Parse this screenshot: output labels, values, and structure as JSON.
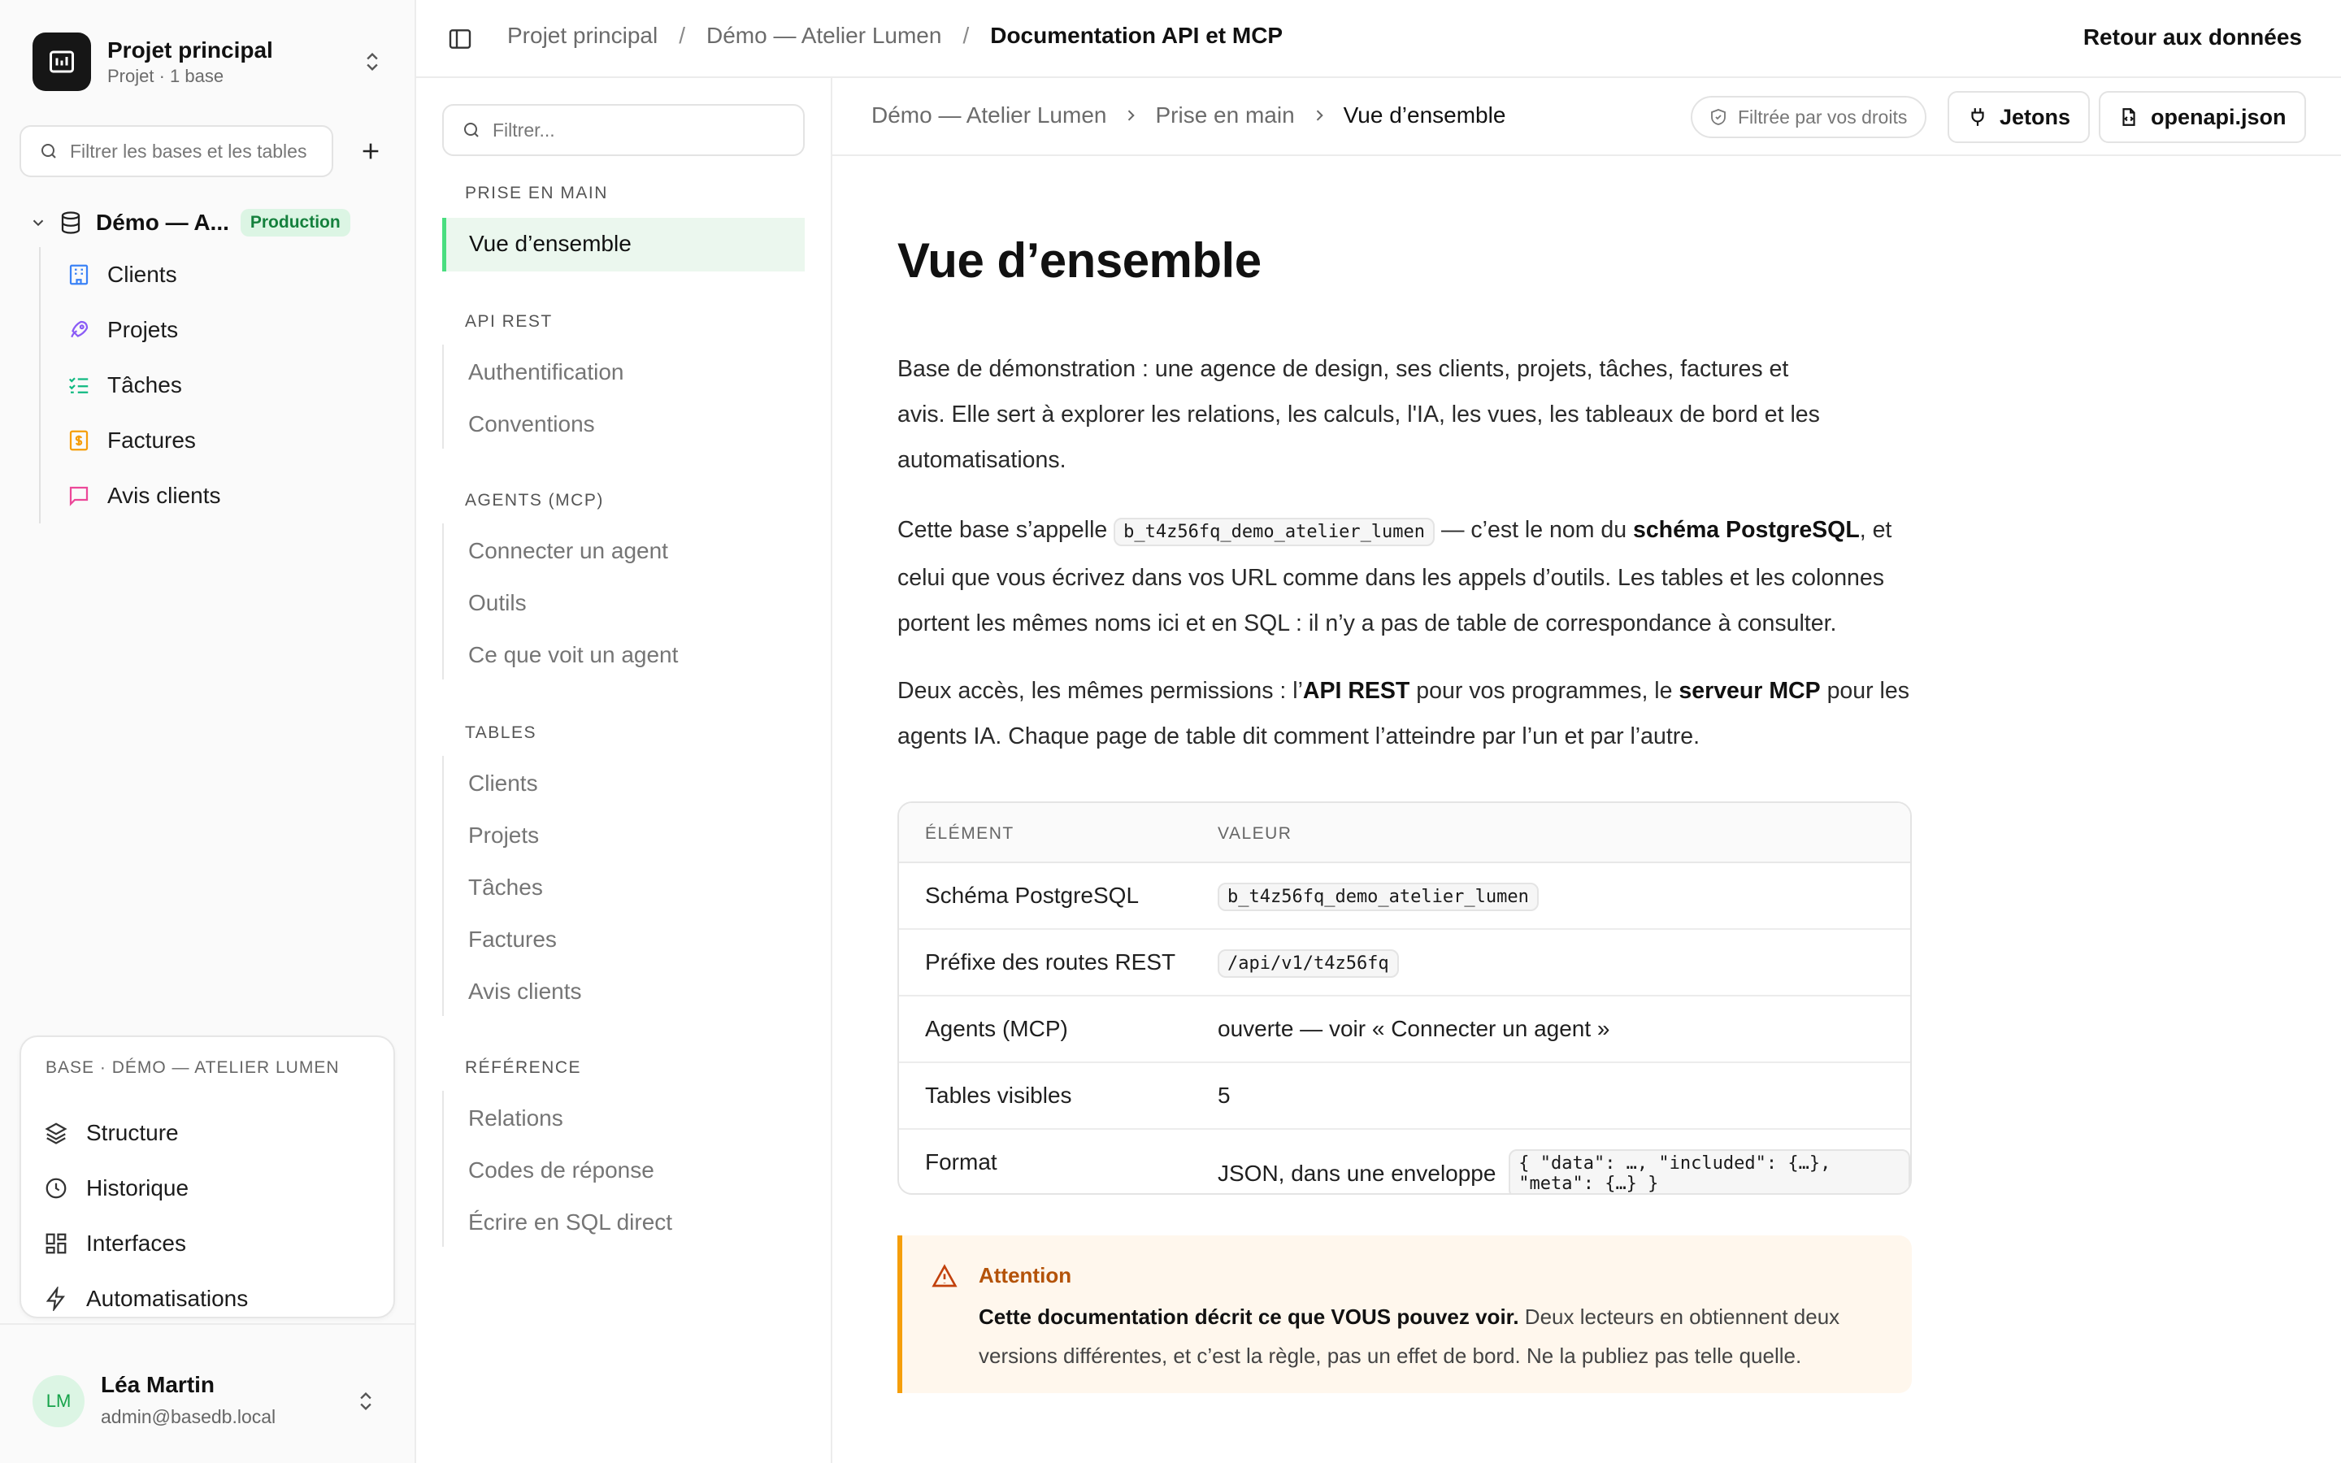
{
  "sidebar": {
    "project_title": "Projet principal",
    "project_sub": "Projet · 1 base",
    "search_placeholder": "Filtrer les bases et les tables",
    "db": {
      "name": "Démo — A...",
      "badge": "Production"
    },
    "tables": [
      {
        "label": "Clients",
        "icon": "building-icon",
        "color": "#3b82f6"
      },
      {
        "label": "Projets",
        "icon": "rocket-icon",
        "color": "#8b5cf6"
      },
      {
        "label": "Tâches",
        "icon": "checklist-icon",
        "color": "#10b981"
      },
      {
        "label": "Factures",
        "icon": "invoice-icon",
        "color": "#f59e0b"
      },
      {
        "label": "Avis clients",
        "icon": "message-icon",
        "color": "#ec4899"
      }
    ],
    "base_card": {
      "caption": "BASE · DÉMO — ATELIER LUMEN",
      "items": [
        {
          "label": "Structure",
          "icon": "layers-icon"
        },
        {
          "label": "Historique",
          "icon": "clock-icon"
        },
        {
          "label": "Interfaces",
          "icon": "grid-icon"
        },
        {
          "label": "Automatisations",
          "icon": "bolt-icon"
        }
      ]
    },
    "user": {
      "initials": "LM",
      "name": "Léa Martin",
      "email": "admin@basedb.local"
    }
  },
  "topbar": {
    "crumbs": [
      "Projet principal",
      "Démo — Atelier Lumen"
    ],
    "current": "Documentation API et MCP",
    "back_label": "Retour aux données"
  },
  "docnav": {
    "search_placeholder": "Filtrer...",
    "sections": [
      {
        "title": "PRISE EN MAIN",
        "items": [
          "Vue d’ensemble"
        ]
      },
      {
        "title": "API REST",
        "items": [
          "Authentification",
          "Conventions"
        ]
      },
      {
        "title": "AGENTS (MCP)",
        "items": [
          "Connecter un agent",
          "Outils",
          "Ce que voit un agent"
        ]
      },
      {
        "title": "TABLES",
        "items": [
          "Clients",
          "Projets",
          "Tâches",
          "Factures",
          "Avis clients"
        ]
      },
      {
        "title": "RÉFÉRENCE",
        "items": [
          "Relations",
          "Codes de réponse",
          "Écrire en SQL direct"
        ]
      }
    ]
  },
  "content": {
    "crumbs": [
      "Démo — Atelier Lumen",
      "Prise en main"
    ],
    "current": "Vue d’ensemble",
    "filter_pill": "Filtrée par vos droits",
    "btn_tokens": "Jetons",
    "btn_openapi": "openapi.json",
    "title": "Vue d’ensemble",
    "p1": "Base de démonstration : une agence de design, ses clients, projets, tâches, factures et avis. Elle sert à explorer les relations, les calculs, l'IA, les vues, les tableaux de bord et les automatisations.",
    "p2": {
      "a": "Cette base s’appelle ",
      "code": "b_t4z56fq_demo_atelier_lumen",
      "b": " — c’est le nom du ",
      "bold": "schéma PostgreSQL",
      "c": ", et celui que vous écrivez dans vos URL comme dans les appels d’outils. Les tables et les colonnes portent les mêmes noms ici et en SQL : il n’y a pas de table de correspondance à consulter."
    },
    "p3": {
      "a": "Deux accès, les mêmes permissions : l’",
      "bold1": "API REST",
      "b": " pour vos programmes, le ",
      "bold2": "serveur MCP",
      "c": " pour les agents IA. Chaque page de table dit comment l’atteindre par l’un et par l’autre."
    },
    "table": {
      "headers": [
        "ÉLÉMENT",
        "VALEUR"
      ],
      "rows": [
        {
          "key": "Schéma PostgreSQL",
          "code": "b_t4z56fq_demo_atelier_lumen"
        },
        {
          "key": "Préfixe des routes REST",
          "code": "/api/v1/t4z56fq"
        },
        {
          "key": "Agents (MCP)",
          "text": "ouverte — voir « Connecter un agent »"
        },
        {
          "key": "Tables visibles",
          "text": "5"
        },
        {
          "key": "Format",
          "text": "JSON, dans une enveloppe ",
          "code": "{ \"data\": …, \"included\": {…}, \"meta\": {…} }"
        }
      ]
    },
    "alert": {
      "title": "Attention",
      "bold": "Cette documentation décrit ce que VOUS pouvez voir.",
      "rest": " Deux lecteurs en obtiennent deux versions différentes, et c’est la règle, pas un effet de bord. Ne la publiez pas telle quelle."
    }
  }
}
